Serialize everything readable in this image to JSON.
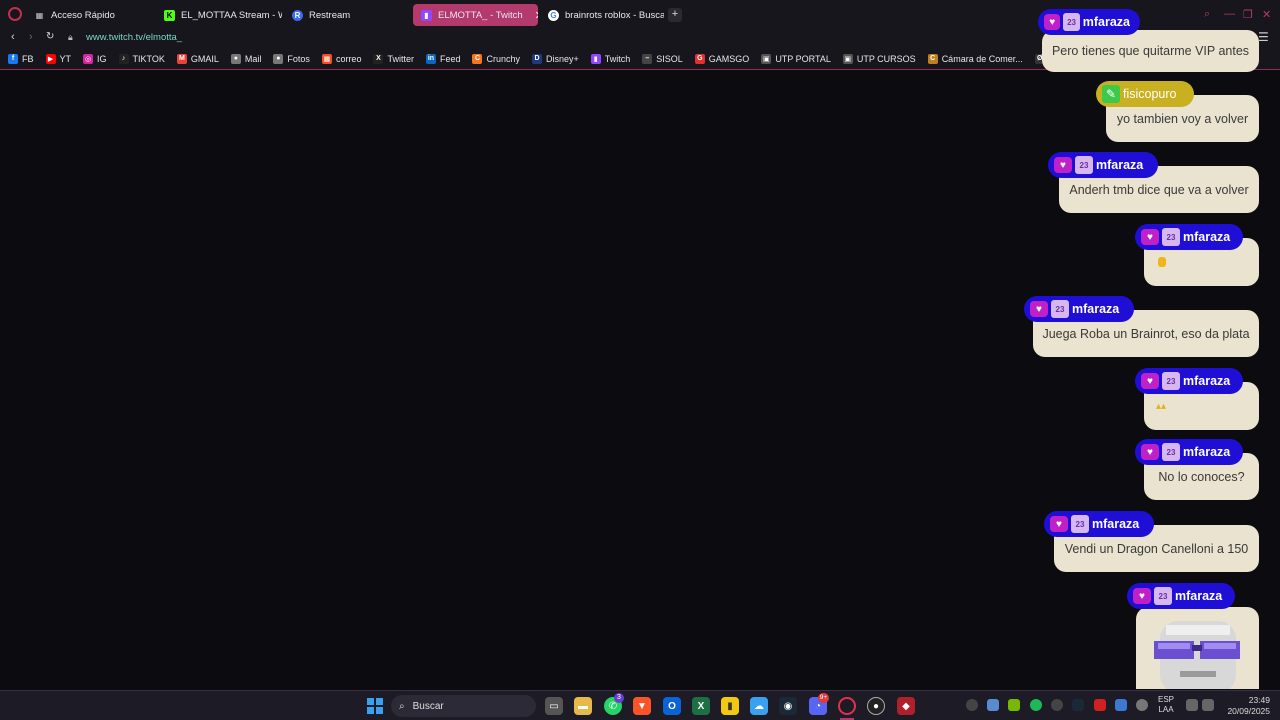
{
  "browser": {
    "tabs": [
      {
        "label": "Acceso Rápido",
        "icon": "grid-icon",
        "color": "#17161c"
      },
      {
        "label": "EL_MOTTAA Stream - Wa",
        "icon": "kick-icon",
        "color": "#53fc18"
      },
      {
        "label": "Restream",
        "icon": "restream-icon",
        "color": "#3b6bf0"
      },
      {
        "label": "ELMOTTA_ - Twitch",
        "icon": "twitch-icon",
        "color": "#9146ff"
      },
      {
        "label": "brainrots roblox - Buscar c",
        "icon": "google-icon",
        "color": "#ffffff"
      }
    ],
    "url": "www.twitch.tv/elmotta_",
    "bookmarks": [
      {
        "label": "FB",
        "icon": "facebook-icon",
        "color": "#1877f2"
      },
      {
        "label": "YT",
        "icon": "youtube-icon",
        "color": "#ff0000"
      },
      {
        "label": "IG",
        "icon": "instagram-icon",
        "color": "#d6249f"
      },
      {
        "label": "TIKTOK",
        "icon": "tiktok-icon",
        "color": "#222222"
      },
      {
        "label": "GMAIL",
        "icon": "gmail-icon",
        "color": "#ea4335"
      },
      {
        "label": "Mail",
        "icon": "apple-icon",
        "color": "#777777"
      },
      {
        "label": "Fotos",
        "icon": "apple-icon",
        "color": "#777777"
      },
      {
        "label": "correo",
        "icon": "microsoft-icon",
        "color": "#f25022"
      },
      {
        "label": "Twitter",
        "icon": "x-icon",
        "color": "#222222"
      },
      {
        "label": "Feed",
        "icon": "linkedin-icon",
        "color": "#0a66c2"
      },
      {
        "label": "Crunchy",
        "icon": "crunchyroll-icon",
        "color": "#f47521"
      },
      {
        "label": "Disney+",
        "icon": "disney-icon",
        "color": "#1f3a7a"
      },
      {
        "label": "Twitch",
        "icon": "twitch-icon",
        "color": "#9146ff"
      },
      {
        "label": "SISOL",
        "icon": "dash-icon",
        "color": "#444444"
      },
      {
        "label": "GAMSGO",
        "icon": "gamsgo-icon",
        "color": "#e03030"
      },
      {
        "label": "UTP PORTAL",
        "icon": "page-icon",
        "color": "#555555"
      },
      {
        "label": "UTP CURSOS",
        "icon": "page-icon",
        "color": "#555555"
      },
      {
        "label": "Cámara de Comer...",
        "icon": "camara-icon",
        "color": "#c08020"
      },
      {
        "label": "Grok",
        "icon": "grok-icon",
        "color": "#333333"
      }
    ]
  },
  "chat": {
    "messages": [
      {
        "user": "mfaraza",
        "text": "Pero tienes que quitarme VIP antes"
      },
      {
        "user": "fisicopuro",
        "text": "yo tambien voy a volver"
      },
      {
        "user": "mfaraza",
        "text": "Anderh tmb dice que va a volver"
      },
      {
        "user": "mfaraza",
        "text": ""
      },
      {
        "user": "mfaraza",
        "text": "Juega Roba un Brainrot, eso da plata"
      },
      {
        "user": "mfaraza",
        "text": ""
      },
      {
        "user": "mfaraza",
        "text": "No lo conoces?"
      },
      {
        "user": "mfaraza",
        "text": "Vendi un Dragon Canelloni a 150"
      },
      {
        "user": "mfaraza",
        "text": ""
      }
    ],
    "badge_text": "23"
  },
  "taskbar": {
    "search_placeholder": "Buscar",
    "lang_top": "ESP",
    "lang_bottom": "LAA",
    "time": "23:49",
    "date": "20/09/2025",
    "whatsapp_badge": "3",
    "discord_badge": "9+"
  }
}
